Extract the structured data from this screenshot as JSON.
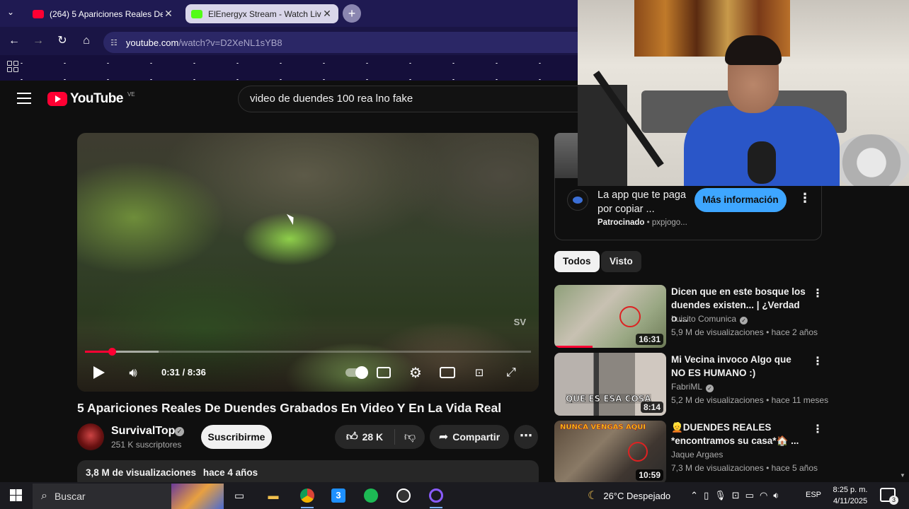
{
  "browser": {
    "tabs": [
      {
        "title": "(264) 5 Apariciones Reales De D",
        "active": true,
        "favicon_color": "#ff0033"
      },
      {
        "title": "ElEnergyx Stream - Watch Live",
        "active": false,
        "favicon_color": "#53fc18"
      }
    ],
    "url_host": "youtube.com",
    "url_path": "/watch?v=D2XeNL1sYB8"
  },
  "youtube": {
    "logo_text": "YouTube",
    "region": "VE",
    "search_query": "video de duendes 100 rea lno fake"
  },
  "player": {
    "watermark": "SV",
    "current_time": "0:31 / 8:36",
    "progress_fraction": 0.06
  },
  "video": {
    "title": "5 Apariciones Reales De Duendes Grabados En Video Y En La Vida Real",
    "channel": "SurvivalTops",
    "subscribers": "251 K suscriptores",
    "subscribe_label": "Suscribirme",
    "likes": "28 K",
    "share_label": "Compartir",
    "views": "3,8 M de visualizaciones",
    "age": "hace 4 años"
  },
  "ad": {
    "title": "La app que te paga por copiar ...",
    "sponsored": "Patrocinado",
    "domain": "pxpjogo...",
    "cta": "Más información"
  },
  "chips": [
    "Todos",
    "Visto"
  ],
  "recommendations": [
    {
      "title": "Dicen que en este bosque los duendes existen... | ¿Verdad o ...",
      "channel": "Luisito Comunica",
      "verified": true,
      "views": "5,9 M de visualizaciones",
      "age": "hace 2 años",
      "duration": "16:31"
    },
    {
      "title": "Mi Vecina invoco Algo que NO ES HUMANO :)",
      "channel": "FabriML",
      "verified": true,
      "views": "5,2 M de visualizaciones",
      "age": "hace 11 meses",
      "duration": "8:14",
      "thumb_text": "QUE ES ESA COSA"
    },
    {
      "title": "👱DUENDES REALES *encontramos su casa*🏠 ...",
      "channel": "Jaque Argaes",
      "verified": false,
      "views": "7,3 M de visualizaciones",
      "age": "hace 5 años",
      "duration": "10:59",
      "thumb_text": "NUNCA VENGAS AQUI"
    }
  ],
  "taskbar": {
    "search_label": "Buscar",
    "weather": "26°C  Despejado",
    "language": "ESP",
    "time": "8:25 p. m.",
    "date": "4/11/2025",
    "notifications": "3"
  }
}
